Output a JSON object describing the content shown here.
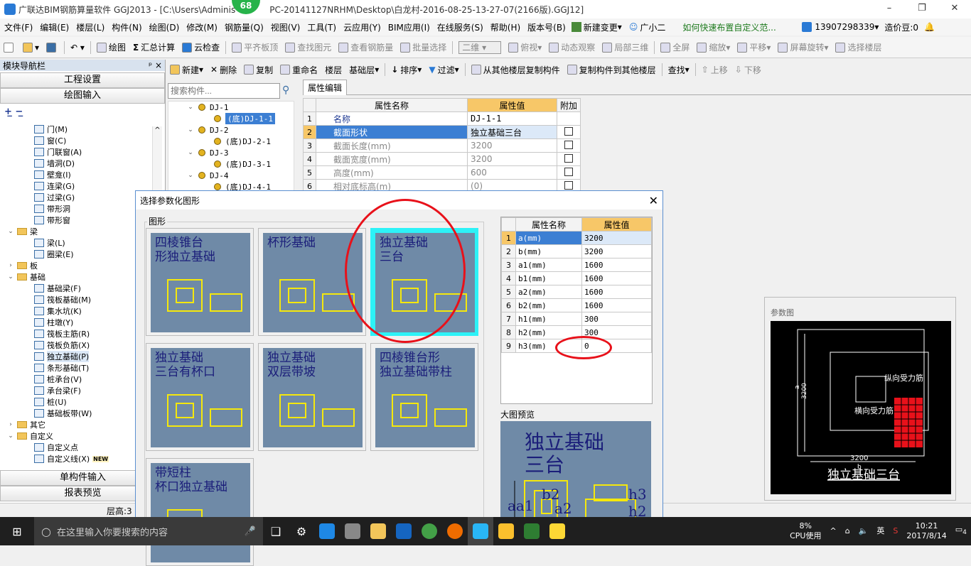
{
  "window": {
    "title": "广联达BIM钢筋算量软件 GGJ2013 - [C:\\Users\\Adminis",
    "title_rest": "PC-20141127NRHM\\Desktop\\白龙村-2016-08-25-13-27-07(2166版).GGJ12]",
    "badge": "68",
    "min": "–",
    "restore": "❐",
    "close": "✕"
  },
  "menu": {
    "items": [
      "文件(F)",
      "编辑(E)",
      "楼层(L)",
      "构件(N)",
      "绘图(D)",
      "修改(M)",
      "钢筋量(Q)",
      "视图(V)",
      "工具(T)",
      "云应用(Y)",
      "BIM应用(I)",
      "在线服务(S)",
      "帮助(H)",
      "版本号(B)"
    ],
    "new_change": "新建变更",
    "xiaoer": "广小二",
    "tip_link": "如何快速布置自定义范...",
    "phone": "13907298339",
    "zaojiadou": "造价豆:0"
  },
  "toolbar1": {
    "draw": "绘图",
    "sum_calc": "汇总计算",
    "cloud_check": "云检查",
    "flat_slab": "平齐板顶",
    "find_elem": "查找图元",
    "view_rebar": "查看钢筋量",
    "batch_select": "批量选择",
    "view_mode": "二维",
    "top_view": "俯视",
    "dynamic_view": "动态观察",
    "local_3d": "局部三维",
    "full_screen": "全屏",
    "zoom": "缩放",
    "pan": "平移",
    "screen_rotate": "屏幕旋转",
    "select_floor": "选择楼层"
  },
  "left_pane": {
    "title": "模块导航栏",
    "pin": "ᵖ",
    "close": "×",
    "project_settings": "工程设置",
    "drawing_input": "绘图输入",
    "tree": [
      {
        "label": "门(M)",
        "level": 2,
        "type": "comp"
      },
      {
        "label": "窗(C)",
        "level": 2,
        "type": "comp"
      },
      {
        "label": "门联窗(A)",
        "level": 2,
        "type": "comp"
      },
      {
        "label": "墙洞(D)",
        "level": 2,
        "type": "comp"
      },
      {
        "label": "壁龛(I)",
        "level": 2,
        "type": "comp"
      },
      {
        "label": "连梁(G)",
        "level": 2,
        "type": "comp"
      },
      {
        "label": "过梁(G)",
        "level": 2,
        "type": "comp"
      },
      {
        "label": "带形洞",
        "level": 2,
        "type": "comp"
      },
      {
        "label": "带形窗",
        "level": 2,
        "type": "comp"
      },
      {
        "label": "梁",
        "level": 1,
        "type": "folder",
        "exp": "⌄"
      },
      {
        "label": "梁(L)",
        "level": 2,
        "type": "comp"
      },
      {
        "label": "圈梁(E)",
        "level": 2,
        "type": "comp"
      },
      {
        "label": "板",
        "level": 1,
        "type": "folder",
        "exp": "›"
      },
      {
        "label": "基础",
        "level": 1,
        "type": "folder",
        "exp": "⌄"
      },
      {
        "label": "基础梁(F)",
        "level": 2,
        "type": "comp"
      },
      {
        "label": "筏板基础(M)",
        "level": 2,
        "type": "comp"
      },
      {
        "label": "集水坑(K)",
        "level": 2,
        "type": "comp"
      },
      {
        "label": "柱墩(Y)",
        "level": 2,
        "type": "comp"
      },
      {
        "label": "筏板主筋(R)",
        "level": 2,
        "type": "comp"
      },
      {
        "label": "筏板负筋(X)",
        "level": 2,
        "type": "comp"
      },
      {
        "label": "独立基础(P)",
        "level": 2,
        "type": "comp",
        "selected": true
      },
      {
        "label": "条形基础(T)",
        "level": 2,
        "type": "comp"
      },
      {
        "label": "桩承台(V)",
        "level": 2,
        "type": "comp"
      },
      {
        "label": "承台梁(F)",
        "level": 2,
        "type": "comp"
      },
      {
        "label": "桩(U)",
        "level": 2,
        "type": "comp"
      },
      {
        "label": "基础板带(W)",
        "level": 2,
        "type": "comp"
      },
      {
        "label": "其它",
        "level": 1,
        "type": "folder",
        "exp": "›"
      },
      {
        "label": "自定义",
        "level": 1,
        "type": "folder",
        "exp": "⌄"
      },
      {
        "label": "自定义点",
        "level": 2,
        "type": "comp"
      },
      {
        "label": "自定义线(X)",
        "level": 2,
        "type": "comp",
        "badge": "NEW"
      }
    ],
    "single_input": "单构件输入",
    "report_preview": "报表预览"
  },
  "status": {
    "floor_height": "层高:3"
  },
  "toolbar2": {
    "new": "新建",
    "delete": "删除",
    "copy": "复制",
    "rename": "重命名",
    "floor_label": "楼层",
    "floor_value": "基础层",
    "sort": "排序",
    "filter": "过滤",
    "copy_from_other": "从其他楼层复制构件",
    "copy_to_other": "复制构件到其他楼层",
    "find": "查找",
    "move_up": "上移",
    "move_down": "下移"
  },
  "component_search": {
    "placeholder": "搜索构件..."
  },
  "component_tree": [
    {
      "label": "DJ-1",
      "level": 1
    },
    {
      "label": "(底)DJ-1-1",
      "level": 2,
      "selected": true
    },
    {
      "label": "DJ-2",
      "level": 1
    },
    {
      "label": "(底)DJ-2-1",
      "level": 2
    },
    {
      "label": "DJ-3",
      "level": 1
    },
    {
      "label": "(底)DJ-3-1",
      "level": 2
    },
    {
      "label": "DJ-4",
      "level": 1
    },
    {
      "label": "(底)DJ-4-1",
      "level": 2
    }
  ],
  "property_editor": {
    "tab": "属性编辑",
    "headers": {
      "name": "属性名称",
      "value": "属性值",
      "extra": "附加"
    },
    "rows": [
      {
        "idx": "1",
        "name": "名称",
        "value": "DJ-1-1",
        "checkbox": false,
        "style": "blue"
      },
      {
        "idx": "2",
        "name": "截面形状",
        "value": "独立基础三台",
        "checkbox": true,
        "style": "hl"
      },
      {
        "idx": "3",
        "name": "截面长度(mm)",
        "value": "3200",
        "checkbox": true,
        "style": "gray"
      },
      {
        "idx": "4",
        "name": "截面宽度(mm)",
        "value": "3200",
        "checkbox": true,
        "style": "gray"
      },
      {
        "idx": "5",
        "name": "高度(mm)",
        "value": "600",
        "checkbox": true,
        "style": "gray"
      },
      {
        "idx": "6",
        "name": "相对底标高(m)",
        "value": "(0)",
        "checkbox": true,
        "style": "gray"
      }
    ]
  },
  "dialog": {
    "title": "选择参数化图形",
    "close": "✕",
    "group_label": "图形",
    "shapes": [
      {
        "title": "四棱锥台\n形独立基础",
        "selected": false
      },
      {
        "title": "杯形基础",
        "selected": false
      },
      {
        "title": "独立基础\n三台",
        "selected": true
      },
      {
        "title": "独立基础\n三台有杯口",
        "selected": false
      },
      {
        "title": "独立基础\n双层带坡",
        "selected": false
      },
      {
        "title": "四棱锥台形\n独立基础带柱",
        "selected": false
      },
      {
        "title": "带短柱\n杯口独立基础",
        "selected": false
      }
    ],
    "param_headers": {
      "name": "属性名称",
      "value": "属性值"
    },
    "params": [
      {
        "idx": "1",
        "name": "a(mm)",
        "value": "3200"
      },
      {
        "idx": "2",
        "name": "b(mm)",
        "value": "3200"
      },
      {
        "idx": "3",
        "name": "a1(mm)",
        "value": "1600"
      },
      {
        "idx": "4",
        "name": "b1(mm)",
        "value": "1600"
      },
      {
        "idx": "5",
        "name": "a2(mm)",
        "value": "1600"
      },
      {
        "idx": "6",
        "name": "b2(mm)",
        "value": "1600"
      },
      {
        "idx": "7",
        "name": "h1(mm)",
        "value": "300"
      },
      {
        "idx": "8",
        "name": "h2(mm)",
        "value": "300"
      },
      {
        "idx": "9",
        "name": "h3(mm)",
        "value": "0"
      }
    ],
    "big_preview_label": "大图预览",
    "big_preview_title": "独立基础\n三台"
  },
  "param_diagram": {
    "label": "参数图",
    "dim_a": "3200",
    "dim_b": "3200",
    "sym_a": "a",
    "sym_b": "b",
    "long_rebar": "纵向受力筋",
    "trans_rebar": "横向受力筋",
    "caption": "独立基础三台"
  },
  "annotation_color": "#e8111a",
  "taskbar": {
    "search_placeholder": "在这里输入你要搜索的内容",
    "cpu_percent": "8%",
    "cpu_label": "CPU使用",
    "ime": "英",
    "time": "10:21",
    "date": "2017/8/14",
    "notifications": "4"
  }
}
